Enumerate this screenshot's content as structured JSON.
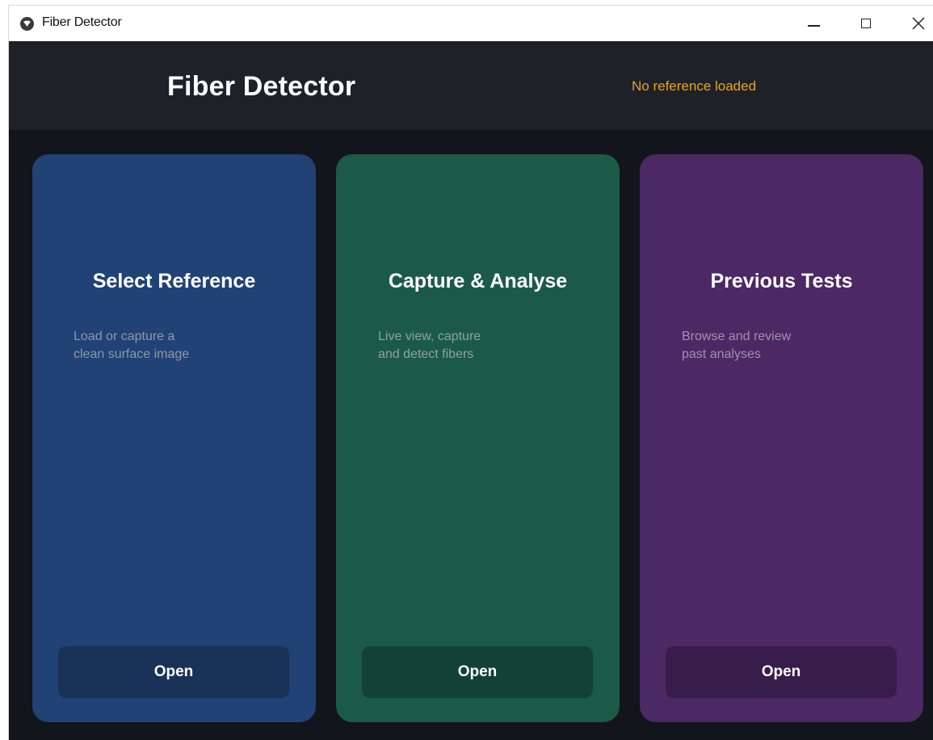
{
  "window": {
    "title": "Fiber Detector",
    "icon": "app-logo-icon",
    "controls": [
      "minimize-icon",
      "maximize-icon",
      "close-icon"
    ]
  },
  "header": {
    "title": "Fiber Detector",
    "status": "No reference loaded",
    "status_color": "#e7a619"
  },
  "cards": [
    {
      "title": "Select Reference",
      "description": "Load or capture a\nclean surface image",
      "button_label": "Open",
      "color": "#214275"
    },
    {
      "title": "Capture & Analyse",
      "description": "Live view, capture\nand detect fibers",
      "button_label": "Open",
      "color": "#1c5a48"
    },
    {
      "title": "Previous Tests",
      "description": "Browse and review\npast analyses",
      "button_label": "Open",
      "color": "#4c2864"
    }
  ]
}
